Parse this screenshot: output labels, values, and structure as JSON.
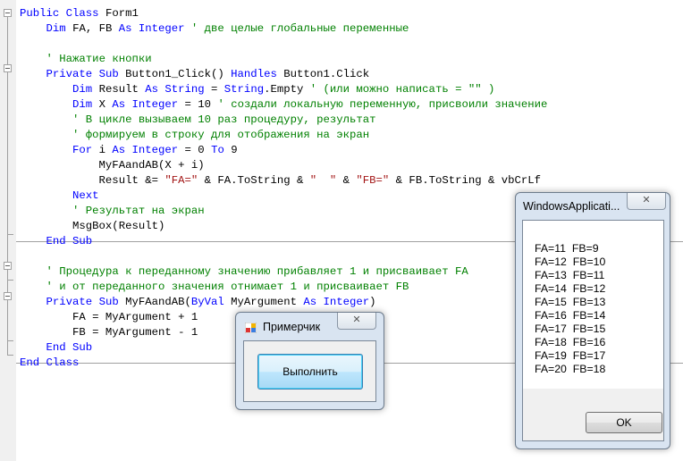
{
  "code": {
    "lines": [
      [
        [
          "kw",
          "Public Class "
        ],
        [
          "",
          "Form1"
        ]
      ],
      [
        [
          "",
          "    "
        ],
        [
          "kw",
          "Dim "
        ],
        [
          "",
          "FA, FB "
        ],
        [
          "kw",
          "As Integer "
        ],
        [
          "cm",
          "' две целые глобальные переменные"
        ]
      ],
      [
        [
          "",
          ""
        ]
      ],
      [
        [
          "",
          "    "
        ],
        [
          "cm",
          "' Нажатие кнопки"
        ]
      ],
      [
        [
          "",
          "    "
        ],
        [
          "kw",
          "Private Sub "
        ],
        [
          "",
          "Button1_Click() "
        ],
        [
          "kw",
          "Handles "
        ],
        [
          "",
          "Button1.Click"
        ]
      ],
      [
        [
          "",
          "        "
        ],
        [
          "kw",
          "Dim "
        ],
        [
          "",
          "Result "
        ],
        [
          "kw",
          "As String "
        ],
        [
          "",
          "= "
        ],
        [
          "kw",
          "String"
        ],
        [
          "",
          ".Empty "
        ],
        [
          "cm",
          "' (или можно написать = \"\" )"
        ]
      ],
      [
        [
          "",
          "        "
        ],
        [
          "kw",
          "Dim "
        ],
        [
          "",
          "X "
        ],
        [
          "kw",
          "As Integer "
        ],
        [
          "",
          "= 10 "
        ],
        [
          "cm",
          "' создали локальную переменную, присвоили значение"
        ]
      ],
      [
        [
          "",
          "        "
        ],
        [
          "cm",
          "' В цикле вызываем 10 раз процедуру, результат"
        ]
      ],
      [
        [
          "",
          "        "
        ],
        [
          "cm",
          "' формируем в строку для отображения на экран"
        ]
      ],
      [
        [
          "",
          "        "
        ],
        [
          "kw",
          "For "
        ],
        [
          "",
          "i "
        ],
        [
          "kw",
          "As Integer "
        ],
        [
          "",
          "= 0 "
        ],
        [
          "kw",
          "To "
        ],
        [
          "",
          "9"
        ]
      ],
      [
        [
          "",
          "            MyFAandAB(X + i)"
        ]
      ],
      [
        [
          "",
          "            Result &= "
        ],
        [
          "st",
          "\"FA=\""
        ],
        [
          "",
          " & FA.ToString & "
        ],
        [
          "st",
          "\"  \""
        ],
        [
          "",
          " & "
        ],
        [
          "st",
          "\"FB=\""
        ],
        [
          "",
          " & FB.ToString & vbCrLf"
        ]
      ],
      [
        [
          "",
          "        "
        ],
        [
          "kw",
          "Next"
        ]
      ],
      [
        [
          "",
          "        "
        ],
        [
          "cm",
          "' Результат на экран"
        ]
      ],
      [
        [
          "",
          "        MsgBox(Result)"
        ]
      ],
      [
        [
          "",
          "    "
        ],
        [
          "kw",
          "End Sub"
        ]
      ],
      [
        [
          "",
          ""
        ]
      ],
      [
        [
          "",
          "    "
        ],
        [
          "cm",
          "' Процедура к переданному значению прибавляет 1 и присваивает FA"
        ]
      ],
      [
        [
          "",
          "    "
        ],
        [
          "cm",
          "' и от переданного значения отнимает 1 и присваивает FB"
        ]
      ],
      [
        [
          "",
          "    "
        ],
        [
          "kw",
          "Private Sub "
        ],
        [
          "",
          "MyFAandAB("
        ],
        [
          "kw",
          "ByVal "
        ],
        [
          "",
          "MyArgument "
        ],
        [
          "kw",
          "As Integer"
        ],
        [
          "",
          ")"
        ]
      ],
      [
        [
          "",
          "        FA = MyArgument + 1"
        ]
      ],
      [
        [
          "",
          "        FB = MyArgument - 1"
        ]
      ],
      [
        [
          "",
          "    "
        ],
        [
          "kw",
          "End Sub"
        ]
      ],
      [
        [
          "kw",
          "End Class"
        ]
      ]
    ]
  },
  "form_window": {
    "title": "Примерчик",
    "close_glyph": "✕",
    "button_label": "Выполнить"
  },
  "msgbox": {
    "title": "WindowsApplicati...",
    "close_glyph": "✕",
    "lines": [
      "FA=11  FB=9",
      "FA=12  FB=10",
      "FA=13  FB=11",
      "FA=14  FB=12",
      "FA=15  FB=13",
      "FA=16  FB=14",
      "FA=17  FB=15",
      "FA=18  FB=16",
      "FA=19  FB=17",
      "FA=20  FB=18"
    ],
    "ok_label": "OK"
  }
}
